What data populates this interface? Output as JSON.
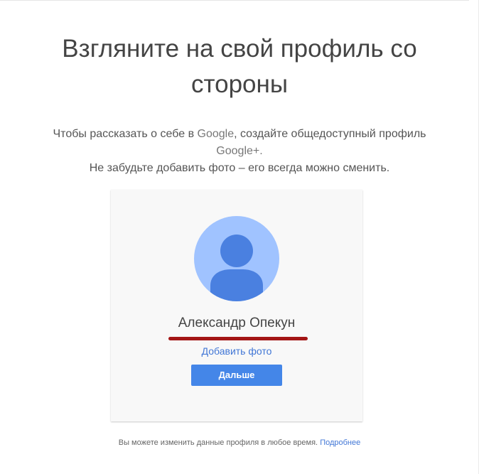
{
  "heading": {
    "line1": "Взгляните на свой профиль со",
    "line2": "стороны"
  },
  "intro": {
    "line1_prefix": "Чтобы рассказать о себе в ",
    "line1_brand": "Google",
    "line1_suffix": ", создайте общедоступный профиль",
    "line2": "Google+.",
    "line3": "Не забудьте добавить фото – его всегда можно сменить."
  },
  "profile_card": {
    "avatar_icon": "default-person-avatar-icon",
    "user_name": "Александр Опекун",
    "add_photo_link": "Добавить фото",
    "next_button": "Дальше"
  },
  "footer": {
    "note": "Вы можете изменить данные профиля в любое время.",
    "learn_more_link": "Подробнее"
  },
  "colors": {
    "button_blue": "#4486e8",
    "link_blue": "#4277d6",
    "avatar_background": "#a0c3ff",
    "avatar_figure": "#4a80e0",
    "name_underline_mark": "#a31515"
  }
}
